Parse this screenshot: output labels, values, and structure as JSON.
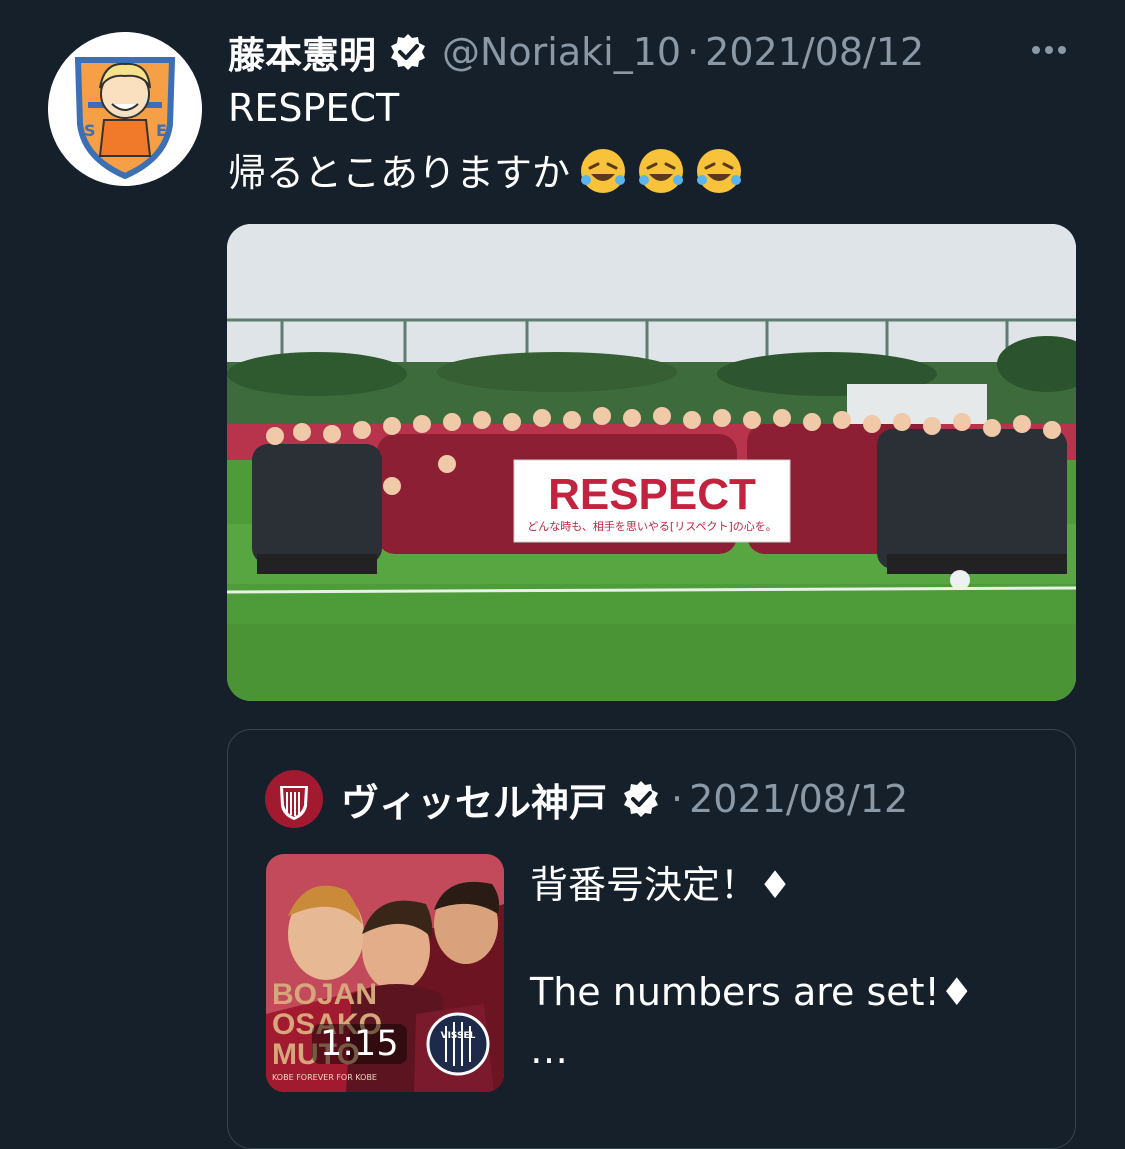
{
  "tweet": {
    "author_name": "藤本憲明",
    "handle": "@Noriaki_10",
    "separator": "·",
    "date": "2021/08/12",
    "text_line1": "RESPECT",
    "text_line2": "帰るとこありますか",
    "emoji": [
      "rolling-on-floor-laughing",
      "rolling-on-floor-laughing",
      "rolling-on-floor-laughing"
    ],
    "photo": {
      "banner_title": "RESPECT",
      "banner_subtitle": "どんな時も、相手を思いやる[リスペクト]の心を。"
    }
  },
  "quoted": {
    "author_name": "ヴィッセル神戸",
    "separator": "·",
    "date": "2021/08/12",
    "line1": "背番号決定！♦",
    "line2": "The numbers are set!♦",
    "ellipsis": "…",
    "video": {
      "duration": "1:15",
      "names": [
        "BOJAN",
        "OSAKO",
        "MUTO"
      ],
      "caption": "KOBE FOREVER FOR KOBE",
      "logo_text": "VISSEL"
    }
  },
  "colors": {
    "background": "#15202b",
    "secondary_text": "#8b98a5",
    "border": "#38444d",
    "club_red": "#a11a30"
  }
}
